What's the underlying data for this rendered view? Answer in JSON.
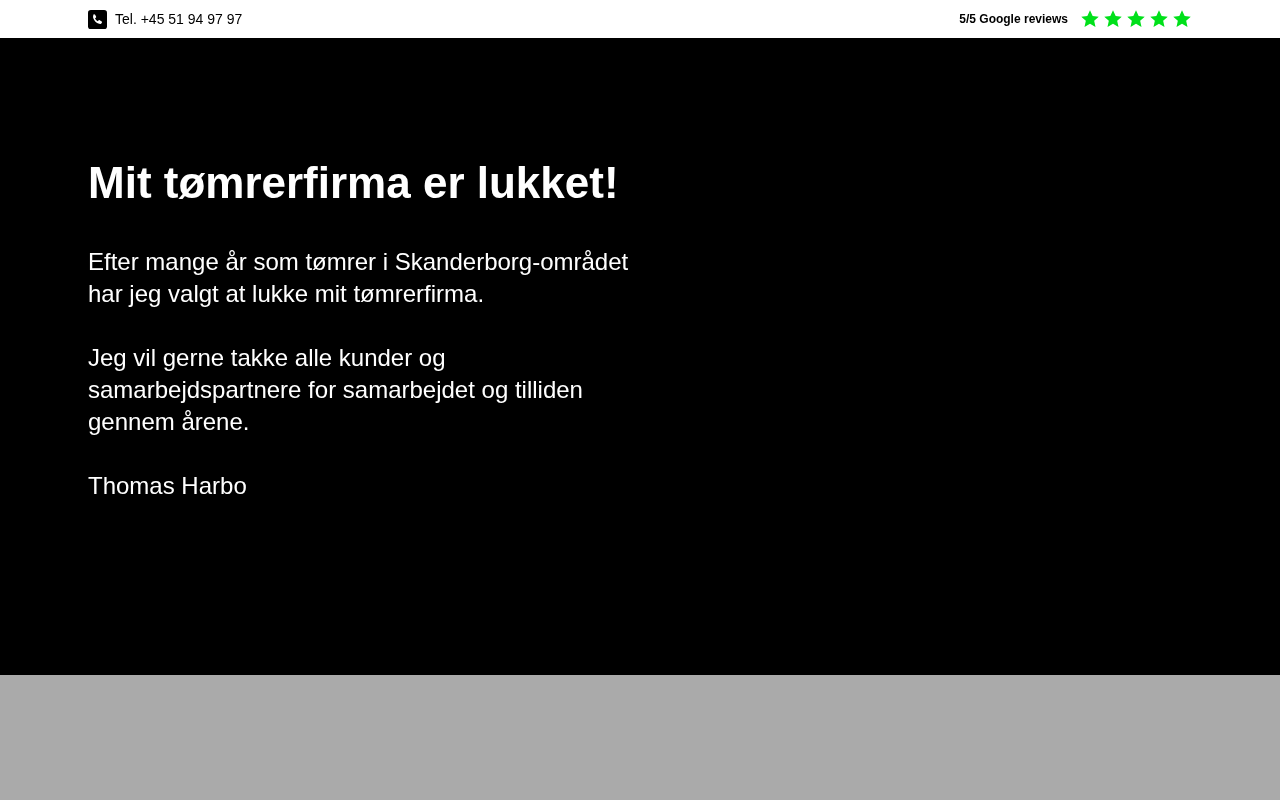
{
  "top_bar": {
    "phone": "Tel. +45 51 94 97 97",
    "reviews": {
      "label": "5/5 Google reviews",
      "stars": 5
    }
  },
  "hero": {
    "heading": "Mit tømrerfirma er lukket!",
    "paragraphs": [
      "Efter mange år som tømrer i Skanderborg-området har jeg valgt at lukke mit tømrerfirma.",
      "Jeg vil gerne takke alle kunder og samarbejdspartnere for samarbejdet og tilliden gennem årene.",
      "Thomas Harbo"
    ]
  }
}
